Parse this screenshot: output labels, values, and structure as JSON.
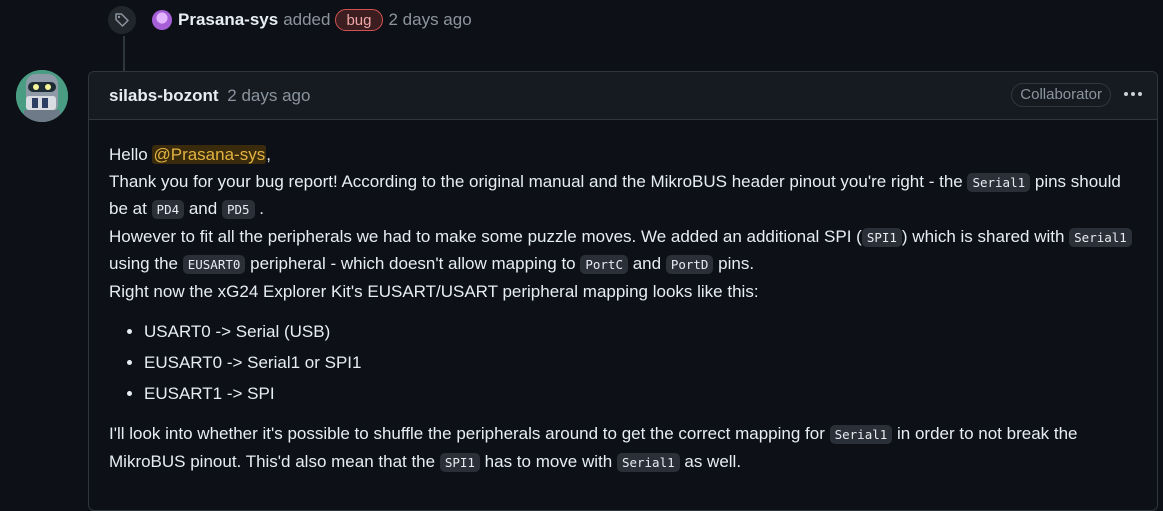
{
  "event": {
    "user": "Prasana-sys",
    "action": "added",
    "label": "bug",
    "time": "2 days ago"
  },
  "comment": {
    "author": "silabs-bozont",
    "time": "2 days ago",
    "role": "Collaborator",
    "body": {
      "greeting": "Hello ",
      "mention": "@Prasana-sys",
      "greeting_end": ",",
      "p1_a": "Thank you for your bug report! According to the original manual and the MikroBUS header pinout you're right - the ",
      "code_serial1": "Serial1",
      "p1_b": " pins should be at ",
      "code_pd4": "PD4",
      "p1_c": " and ",
      "code_pd5": "PD5",
      "p1_d": " .",
      "p2_a": "However to fit all the peripherals we had to make some puzzle moves. We added an additional SPI (",
      "code_spi1": "SPI1",
      "p2_b": ") which is shared with ",
      "p2_c": " using the ",
      "code_eusart0": "EUSART0",
      "p2_d": " peripheral - which doesn't allow mapping to ",
      "code_portc": "PortC",
      "p2_e": " and ",
      "code_portd": "PortD",
      "p2_f": " pins.",
      "p3": "Right now the xG24 Explorer Kit's EUSART/USART peripheral mapping looks like this:",
      "list": [
        "USART0 -> Serial (USB)",
        "EUSART0 -> Serial1 or SPI1",
        "EUSART1 -> SPI"
      ],
      "p4_a": "I'll look into whether it's possible to shuffle the peripherals around to get the correct mapping for ",
      "p4_b": " in order to not break the MikroBUS pinout. This'd also mean that the ",
      "p4_c": " has to move with ",
      "p4_d": " as well."
    }
  },
  "colors": {
    "background": "#0d1117",
    "border": "#30363d",
    "label_bug": "#d05252",
    "mention": "#e3b341"
  },
  "icons": [
    "tag-icon",
    "kebab-horizontal-icon"
  ]
}
